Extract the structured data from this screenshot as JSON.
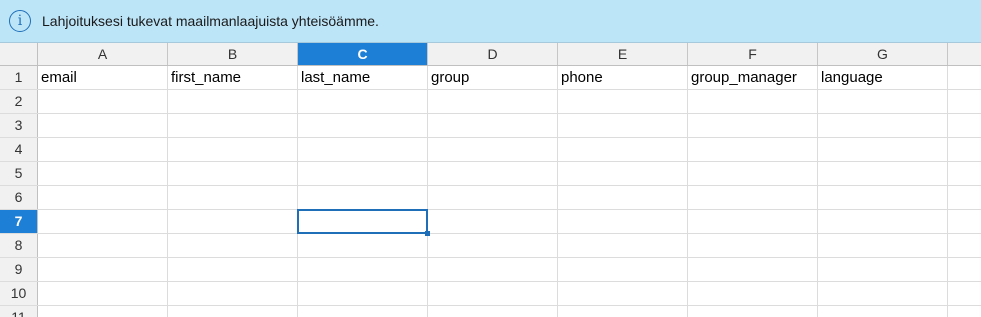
{
  "infobar": {
    "icon": "info-icon",
    "icon_glyph": "i",
    "message": "Lahjoituksesi tukevat maailmanlaajuista yhteisöämme."
  },
  "sheet": {
    "columns": [
      "A",
      "B",
      "C",
      "D",
      "E",
      "F",
      "G"
    ],
    "rows": [
      "1",
      "2",
      "3",
      "4",
      "5",
      "6",
      "7",
      "8",
      "9",
      "10",
      "11"
    ],
    "selected_column": "C",
    "selected_row": "7",
    "row1_values": [
      "email",
      "first_name",
      "last_name",
      "group",
      "phone",
      "group_manager",
      "language"
    ]
  },
  "colors": {
    "infobar_bg": "#bde5f8",
    "selection_accent": "#1e7fd6",
    "header_bg": "#f1f1f1"
  }
}
